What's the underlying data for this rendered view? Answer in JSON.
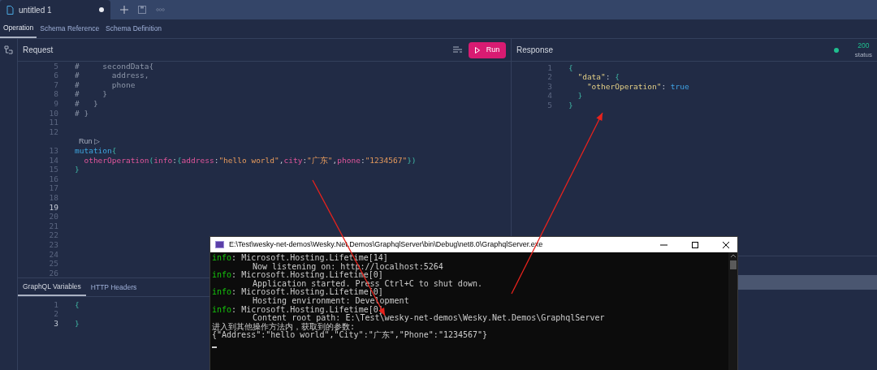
{
  "document_tabs": [
    {
      "title": "untitled 1",
      "unsaved": true,
      "selected": true
    }
  ],
  "section_tabs": [
    {
      "label": "Operation",
      "selected": true
    },
    {
      "label": "Schema Reference",
      "selected": false
    },
    {
      "label": "Schema Definition",
      "selected": false
    }
  ],
  "request": {
    "title": "Request",
    "run_button": "Run",
    "lines": [
      {
        "number": "5",
        "current": false,
        "tokens": [
          {
            "kind": "comment",
            "text": "#     secondData{"
          }
        ]
      },
      {
        "number": "6",
        "current": false,
        "tokens": [
          {
            "kind": "comment",
            "text": "#       address,"
          }
        ]
      },
      {
        "number": "7",
        "current": false,
        "tokens": [
          {
            "kind": "comment",
            "text": "#       phone"
          }
        ]
      },
      {
        "number": "8",
        "current": false,
        "tokens": [
          {
            "kind": "comment",
            "text": "#     }"
          }
        ]
      },
      {
        "number": "9",
        "current": false,
        "tokens": [
          {
            "kind": "comment",
            "text": "#   }"
          }
        ]
      },
      {
        "number": "10",
        "current": false,
        "tokens": [
          {
            "kind": "comment",
            "text": "# }"
          }
        ]
      },
      {
        "number": "11",
        "current": false
      },
      {
        "number": "12",
        "current": false
      },
      {
        "number": "13",
        "current": false,
        "lens": "Run ▷",
        "tokens": [
          {
            "kind": "keyword",
            "text": "mutation"
          },
          {
            "kind": "brace",
            "text": "{"
          }
        ]
      },
      {
        "number": "14",
        "current": false,
        "tokens": [
          {
            "kind": "field",
            "text": "  otherOperation"
          },
          {
            "kind": "brace",
            "text": "("
          },
          {
            "kind": "field",
            "text": "info"
          },
          {
            "kind": "punct",
            "text": ":"
          },
          {
            "kind": "brace",
            "text": "{"
          },
          {
            "kind": "field",
            "text": "address"
          },
          {
            "kind": "punct",
            "text": ":"
          },
          {
            "kind": "string",
            "text": "\"hello world\""
          },
          {
            "kind": "punct",
            "text": ","
          },
          {
            "kind": "field",
            "text": "city"
          },
          {
            "kind": "punct",
            "text": ":"
          },
          {
            "kind": "string",
            "text": "\"广东\""
          },
          {
            "kind": "punct",
            "text": ","
          },
          {
            "kind": "field",
            "text": "phone"
          },
          {
            "kind": "punct",
            "text": ":"
          },
          {
            "kind": "string",
            "text": "\"1234567\""
          },
          {
            "kind": "brace",
            "text": "})"
          }
        ]
      },
      {
        "number": "15",
        "current": false,
        "tokens": [
          {
            "kind": "brace",
            "text": "}"
          }
        ]
      },
      {
        "number": "16",
        "current": false
      },
      {
        "number": "17",
        "current": false
      },
      {
        "number": "18",
        "current": false
      },
      {
        "number": "19",
        "current": true
      },
      {
        "number": "20",
        "current": false
      },
      {
        "number": "21",
        "current": false
      },
      {
        "number": "22",
        "current": false
      },
      {
        "number": "23",
        "current": false
      },
      {
        "number": "24",
        "current": false
      },
      {
        "number": "25",
        "current": false
      },
      {
        "number": "26",
        "current": false
      }
    ]
  },
  "bottom_tabs": [
    {
      "label": "GraphQL Variables",
      "selected": true
    },
    {
      "label": "HTTP Headers",
      "selected": false
    }
  ],
  "variables": [
    {
      "number": "1",
      "current": false,
      "tokens": [
        {
          "kind": "brace",
          "text": "{"
        }
      ]
    },
    {
      "number": "2",
      "current": false
    },
    {
      "number": "3",
      "current": true,
      "tokens": [
        {
          "kind": "brace",
          "text": "}"
        }
      ]
    }
  ],
  "response": {
    "title": "Response",
    "status": {
      "code": "200",
      "label": "status",
      "color": "#1fbf8f"
    },
    "lines": [
      {
        "number": "1",
        "current": false,
        "tokens": [
          {
            "kind": "brace",
            "text": "{"
          }
        ]
      },
      {
        "number": "2",
        "current": false,
        "tokens": [
          {
            "kind": "key",
            "text": "  \"data\""
          },
          {
            "kind": "punct",
            "text": ": "
          },
          {
            "kind": "brace",
            "text": "{"
          }
        ]
      },
      {
        "number": "3",
        "current": false,
        "tokens": [
          {
            "kind": "key",
            "text": "    \"otherOperation\""
          },
          {
            "kind": "punct",
            "text": ": "
          },
          {
            "kind": "bool",
            "text": "true"
          }
        ]
      },
      {
        "number": "4",
        "current": false,
        "tokens": [
          {
            "kind": "brace",
            "text": "  }"
          }
        ]
      },
      {
        "number": "5",
        "current": false,
        "tokens": [
          {
            "kind": "brace",
            "text": "}"
          }
        ]
      }
    ]
  },
  "console_window": {
    "title": "E:\\Test\\wesky-net-demos\\Wesky.Net.Demos\\GraphqlServer\\bin\\Debug\\net8.0\\GraphqlServer.exe",
    "lines": [
      {
        "kind": "log",
        "prefix": "info",
        "text": ": Microsoft.Hosting.Lifetime[14]"
      },
      {
        "kind": "detail",
        "text": "Now listening on: http://localhost:5264"
      },
      {
        "kind": "log",
        "prefix": "info",
        "text": ": Microsoft.Hosting.Lifetime[0]"
      },
      {
        "kind": "detail",
        "text": "Application started. Press Ctrl+C to shut down."
      },
      {
        "kind": "log",
        "prefix": "info",
        "text": ": Microsoft.Hosting.Lifetime[0]"
      },
      {
        "kind": "detail",
        "text": "Hosting environment: Development"
      },
      {
        "kind": "log",
        "prefix": "info",
        "text": ": Microsoft.Hosting.Lifetime[0]"
      },
      {
        "kind": "detail",
        "text": "Content root path: E:\\Test\\wesky-net-demos\\Wesky.Net.Demos\\GraphqlServer"
      },
      {
        "kind": "plain",
        "text": "进入到其他操作方法内，获取到的参数:"
      },
      {
        "kind": "plain",
        "text": "{\"Address\":\"hello world\",\"City\":\"广东\",\"Phone\":\"1234567\"}"
      }
    ]
  }
}
